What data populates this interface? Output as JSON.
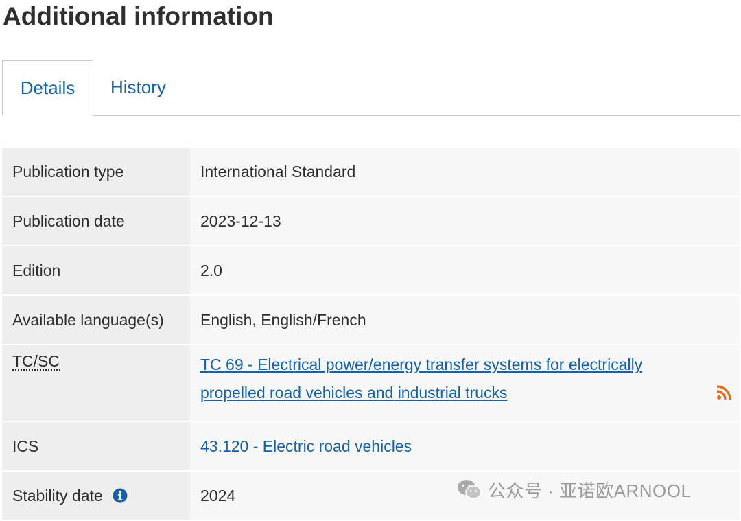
{
  "page": {
    "title": "Additional information"
  },
  "tabs": [
    {
      "label": "Details",
      "active": true
    },
    {
      "label": "History",
      "active": false
    }
  ],
  "details": {
    "publication_type": {
      "label": "Publication type",
      "value": "International Standard"
    },
    "publication_date": {
      "label": "Publication date",
      "value": "2023-12-13"
    },
    "edition": {
      "label": "Edition",
      "value": "2.0"
    },
    "languages": {
      "label": "Available language(s)",
      "value": "English, English/French"
    },
    "tc_sc": {
      "label": "TC/SC",
      "value": "TC 69 - Electrical power/energy transfer systems for electrically propelled road vehicles and industrial trucks"
    },
    "ics": {
      "label": "ICS",
      "value": "43.120 - Electric road vehicles"
    },
    "stability_date": {
      "label": "Stability date",
      "value": "2024"
    }
  },
  "icons": {
    "rss": "rss-icon",
    "info": "info-icon",
    "wechat": "wechat-icon"
  },
  "colors": {
    "link": "#1662a8",
    "rss": "#e8681a",
    "label_bg": "#eeeeee",
    "value_bg": "#f7f7f7"
  },
  "watermark": {
    "text": "公众号 · 亚诺欧ARNOOL"
  }
}
